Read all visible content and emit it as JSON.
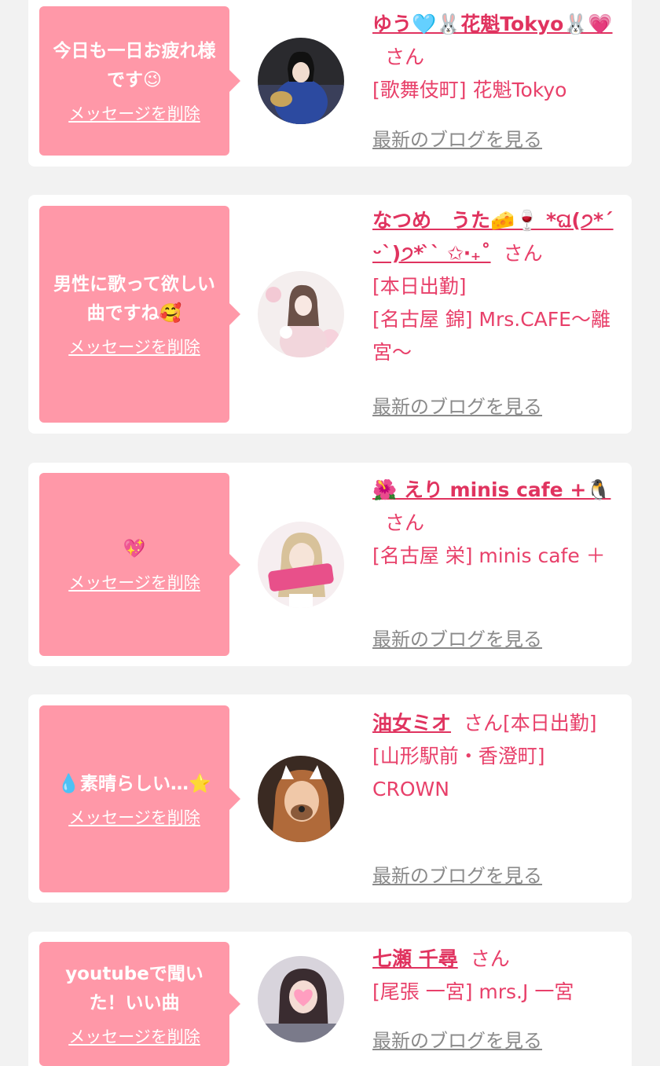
{
  "messages": [
    {
      "text": "今日も一日お疲れ様です😉",
      "delete_label": "メッセージを削除",
      "name": "ゆう🩵🐰花魁Tokyo🐰💗",
      "honorific": "さん",
      "tag": "",
      "shop": "[歌舞伎町] 花魁Tokyo",
      "blog_label": "最新のブログを見る"
    },
    {
      "text": "男性に歌って欲しい曲ですね🥰",
      "delete_label": "メッセージを削除",
      "name": "なつめ　うた🧀🍷 *ଘ(੭*ˊᵕˋ)੭* ̀ˋ ✩‧₊˚",
      "honorific": "さん",
      "tag": "[本日出勤]",
      "shop": "[名古屋 錦] Mrs.CAFE〜離宮〜",
      "blog_label": "最新のブログを見る"
    },
    {
      "text": "💖",
      "delete_label": "メッセージを削除",
      "name": "🌺 えり minis cafe +🐧",
      "honorific": "さん",
      "tag": "",
      "shop": "[名古屋 栄] minis cafe ＋",
      "blog_label": "最新のブログを見る"
    },
    {
      "text": "💧素晴らしい…⭐",
      "delete_label": "メッセージを削除",
      "name": "油女ミオ",
      "honorific": "さん",
      "tag": "[本日出勤]",
      "shop": "[山形駅前・香澄町] CROWN",
      "blog_label": "最新のブログを見る"
    },
    {
      "text": "youtubeで聞いた！いい曲",
      "delete_label": "メッセージを削除",
      "name": "七瀬 千尋",
      "honorific": "さん",
      "tag": "",
      "shop": "[尾張 一宮] mrs.J 一宮",
      "blog_label": "最新のブログを見る"
    }
  ]
}
